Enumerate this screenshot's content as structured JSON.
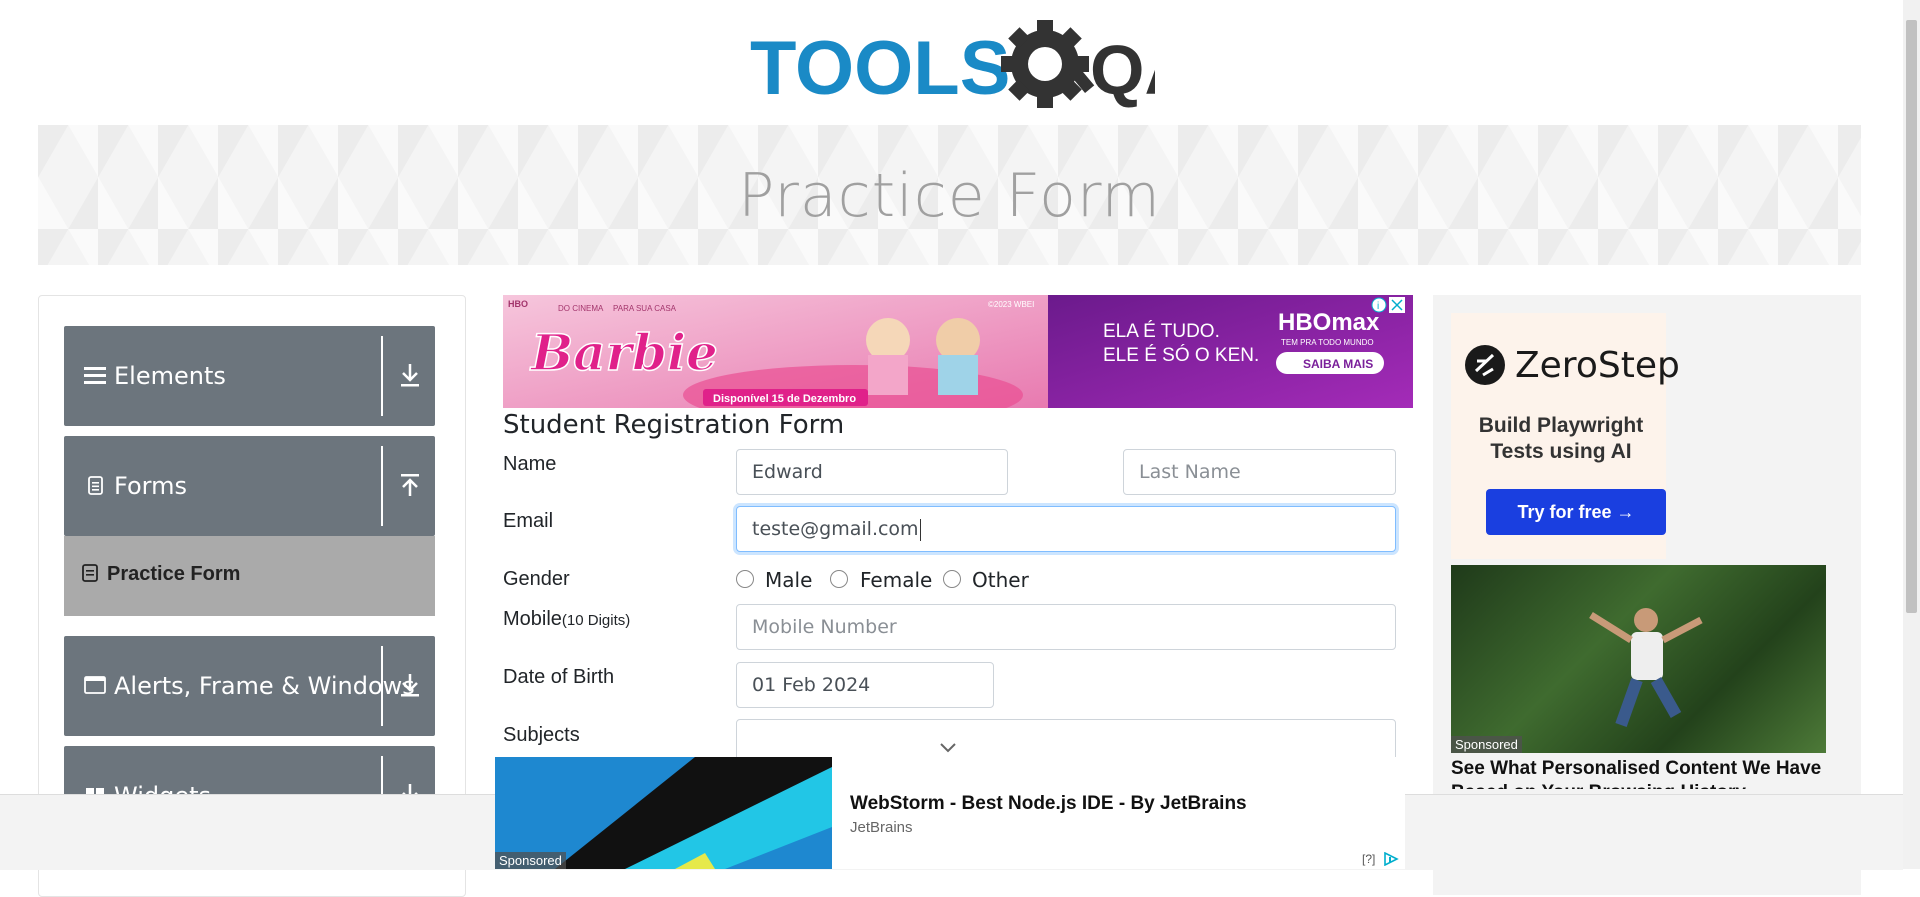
{
  "logo": {
    "text_left": "TOOLS",
    "text_right": "QA"
  },
  "banner": {
    "title": "Practice Form"
  },
  "sidebar": {
    "groups": [
      {
        "label": "Elements",
        "icon": "hamburger-icon",
        "arrow": "download-icon"
      },
      {
        "label": "Forms",
        "icon": "document-icon",
        "arrow": "upload-icon"
      },
      {
        "label": "Alerts, Frame & Windows",
        "icon": "window-icon",
        "arrow": "download-icon"
      },
      {
        "label": "Widgets",
        "icon": "widgets-icon",
        "arrow": "download-icon"
      }
    ],
    "active_item": {
      "label": "Practice Form",
      "icon": "form-icon"
    }
  },
  "top_ad": {
    "badge": "HBO",
    "tagline1": "DO CINEMA",
    "tagline2": "PARA SUA CASA",
    "copyright": "©2023 WBEI",
    "brand": "Barbie",
    "available": "Disponível 15 de Dezembro",
    "text1": "ELA É TUDO.",
    "text2": "ELE É SÓ O KEN.",
    "hbo": "HBOmax",
    "hbo_sub": "TEM PRA TODO MUNDO",
    "cta": "SAIBA MAIS"
  },
  "form": {
    "title": "Student Registration Form",
    "name_label": "Name",
    "first_name_value": "Edward",
    "last_name_placeholder": "Last Name",
    "email_label": "Email",
    "email_value": "teste@gmail.com",
    "gender_label": "Gender",
    "genders": [
      "Male",
      "Female",
      "Other"
    ],
    "mobile_label": "Mobile",
    "mobile_hint": "(10 Digits)",
    "mobile_placeholder": "Mobile Number",
    "dob_label": "Date of Birth",
    "dob_value": "01 Feb 2024",
    "subjects_label": "Subjects"
  },
  "right_ad": {
    "brand": "ZeroStep",
    "headline": "Build Playwright Tests using AI",
    "cta": "Try for free →",
    "sponsored": "Sponsored",
    "caption": "See What Personalised Content We Have Based on Your Browsing History"
  },
  "bottom_ad": {
    "sponsored": "Sponsored",
    "title": "WebStorm - Best Node.js IDE - By JetBrains",
    "advertiser": "JetBrains",
    "info": "[?]"
  },
  "colors": {
    "accent": "#1a8ac6",
    "sidebar": "#6c757d",
    "active": "#aaaaaa",
    "cta": "#1a3fe0"
  }
}
